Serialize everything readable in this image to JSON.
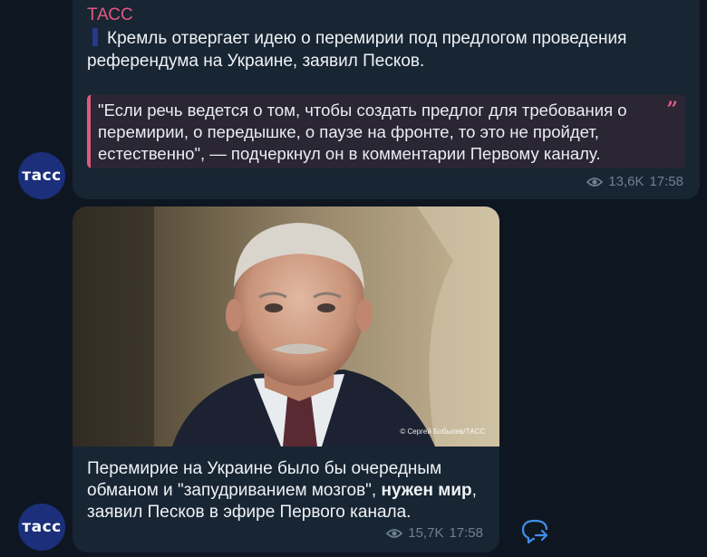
{
  "channel": {
    "name": "ТАСС",
    "avatar_text": "тасс"
  },
  "messages": [
    {
      "sender": "ТАСС",
      "text": "Кремль отвергает идею о перемирии под предлогом проведения референдума на Украине, заявил Песков.",
      "quote": "\"Если речь ведется о том, чтобы создать предлог для требования о перемирии, о передышке, о паузе на фронте, то это не пройдет, естественно\", — подчеркнул он в комментарии Первому каналу.",
      "quote_mark": "”",
      "views": "13,6K",
      "time": "17:58"
    },
    {
      "photo_credit": "© Сергей Бобылев/ТАСС",
      "caption_part1": "Перемирие на Украине было бы очередным обманом и \"запудриванием мозгов\", ",
      "caption_bold": "нужен мир",
      "caption_part2": ", заявил Песков в эфире Первого канала.",
      "views": "15,7K",
      "time": "17:58"
    }
  ],
  "colors": {
    "background": "#0e1621",
    "bubble": "#182533",
    "accent": "#e3587f",
    "avatar": "#1b2f7a",
    "share_icon": "#3f8ee8"
  },
  "icons": {
    "views": "eye-icon",
    "share": "share-icon",
    "flag": "flag-icon"
  }
}
